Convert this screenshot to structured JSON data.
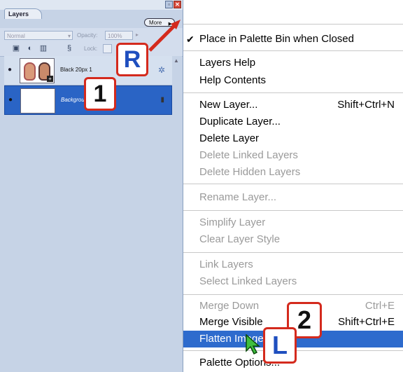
{
  "panel": {
    "tab_label": "Layers",
    "more_label": "More",
    "blend_mode": "Normal",
    "opacity_label": "Opacity:",
    "opacity_value": "100%",
    "lock_label": "Lock:",
    "layers": [
      {
        "name": "Black 20px 1"
      },
      {
        "name": "Background"
      }
    ]
  },
  "menu": {
    "items": [
      {
        "label": "Place in Palette Bin when Closed",
        "checked": true
      },
      {
        "label": "Layers Help"
      },
      {
        "label": "Help Contents"
      },
      {
        "label": "New Layer...",
        "shortcut": "Shift+Ctrl+N"
      },
      {
        "label": "Duplicate Layer..."
      },
      {
        "label": "Delete Layer"
      },
      {
        "label": "Delete Linked Layers",
        "disabled": true
      },
      {
        "label": "Delete Hidden Layers",
        "disabled": true
      },
      {
        "label": "Rename Layer...",
        "disabled": true
      },
      {
        "label": "Simplify Layer",
        "disabled": true
      },
      {
        "label": "Clear Layer Style",
        "disabled": true
      },
      {
        "label": "Link Layers",
        "disabled": true
      },
      {
        "label": "Select Linked Layers",
        "disabled": true
      },
      {
        "label": "Merge Down",
        "shortcut": "Ctrl+E",
        "disabled": true
      },
      {
        "label": "Merge Visible",
        "shortcut": "Shift+Ctrl+E"
      },
      {
        "label": "Flatten Image",
        "highlighted": true
      },
      {
        "label": "Palette Options..."
      }
    ]
  },
  "annotations": {
    "callout_r": "R",
    "callout_1": "1",
    "callout_2": "2",
    "callout_l": "L"
  },
  "colors": {
    "menu_highlight": "#2e6bcd",
    "callout_border": "#d42a1d",
    "panel_background": "#c6d3e6"
  }
}
